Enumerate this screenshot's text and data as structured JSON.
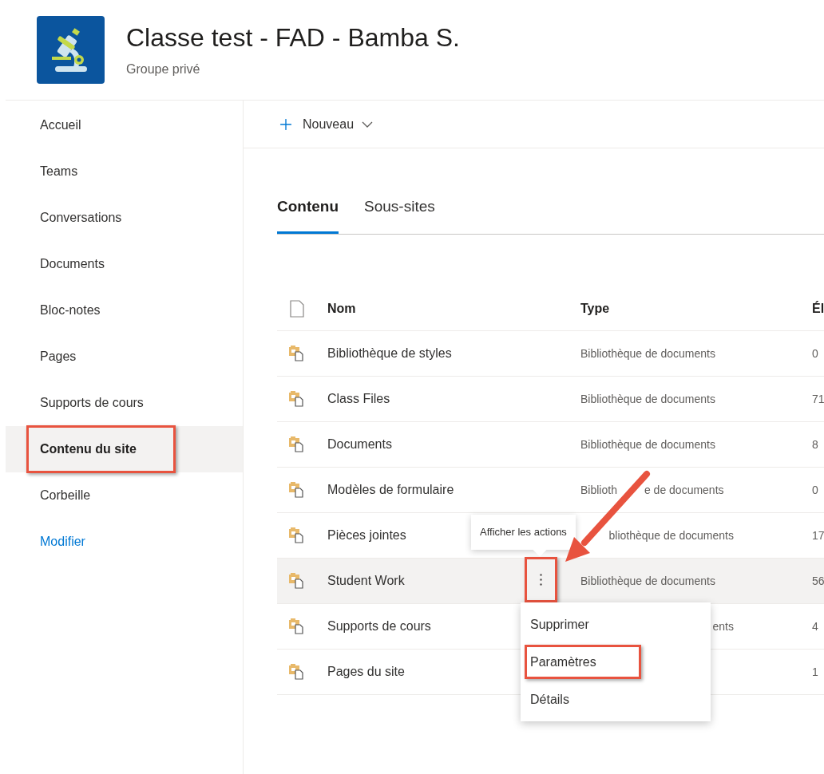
{
  "site": {
    "title": "Classe test - FAD - Bamba S.",
    "subtitle": "Groupe privé"
  },
  "nav": [
    {
      "label": "Accueil",
      "selected": false,
      "highlighted": false,
      "kind": "link"
    },
    {
      "label": "Teams",
      "selected": false,
      "highlighted": false,
      "kind": "link"
    },
    {
      "label": "Conversations",
      "selected": false,
      "highlighted": false,
      "kind": "link"
    },
    {
      "label": "Documents",
      "selected": false,
      "highlighted": false,
      "kind": "link"
    },
    {
      "label": "Bloc-notes",
      "selected": false,
      "highlighted": false,
      "kind": "link"
    },
    {
      "label": "Pages",
      "selected": false,
      "highlighted": false,
      "kind": "link"
    },
    {
      "label": "Supports de cours",
      "selected": false,
      "highlighted": false,
      "kind": "link"
    },
    {
      "label": "Contenu du site",
      "selected": true,
      "highlighted": true,
      "kind": "link"
    },
    {
      "label": "Corbeille",
      "selected": false,
      "highlighted": false,
      "kind": "link"
    },
    {
      "label": "Modifier",
      "selected": false,
      "highlighted": false,
      "kind": "action"
    }
  ],
  "command": {
    "label": "Nouveau"
  },
  "tabs": [
    {
      "label": "Contenu",
      "selected": true
    },
    {
      "label": "Sous-sites",
      "selected": false
    }
  ],
  "table": {
    "columns": [
      {
        "label": "Nom"
      },
      {
        "label": "Type"
      },
      {
        "label": "Él"
      }
    ],
    "rows": [
      {
        "name": "Bibliothèque de styles",
        "type": "Bibliothèque de documents",
        "count": "0",
        "hovered": false,
        "type_cut": false
      },
      {
        "name": "Class Files",
        "type": "Bibliothèque de documents",
        "count": "71",
        "hovered": false,
        "type_cut": false
      },
      {
        "name": "Documents",
        "type": "Bibliothèque de documents",
        "count": "8",
        "hovered": false,
        "type_cut": false
      },
      {
        "name": "Modèles de formulaire",
        "type": "Biblioth",
        "type_rest": "e de documents",
        "count": "0",
        "hovered": false,
        "type_cut": false
      },
      {
        "name": "Pièces jointes",
        "type": "bliothèque de documents",
        "count": "17",
        "hovered": false,
        "type_cut": true
      },
      {
        "name": "Student Work",
        "type": "Bibliothèque de documents",
        "count": "56",
        "hovered": true,
        "type_cut": false
      },
      {
        "name": "Supports de cours",
        "type": "ents",
        "count": "4",
        "hovered": false,
        "type_cut": true
      },
      {
        "name": "Pages du site",
        "count": "1",
        "hovered": false
      }
    ]
  },
  "tooltip": "Afficher les actions",
  "menu": [
    {
      "label": "Supprimer",
      "highlighted": false
    },
    {
      "label": "Paramètres",
      "highlighted": true
    },
    {
      "label": "Détails",
      "highlighted": false
    }
  ]
}
